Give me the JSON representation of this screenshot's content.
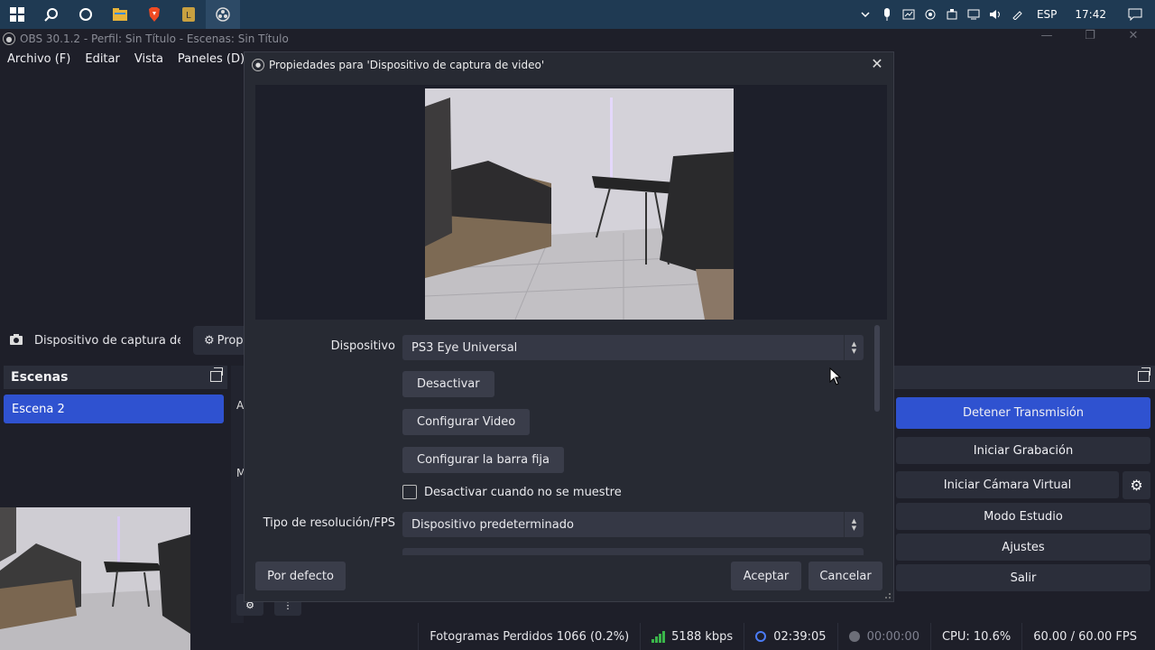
{
  "taskbar": {
    "icons": [
      "windows-start-icon",
      "search-icon",
      "cortana-icon",
      "file-explorer-icon",
      "brave-icon",
      "app-icon",
      "obs-icon"
    ],
    "tray": {
      "language": "ESP",
      "time": "17:42"
    }
  },
  "app": {
    "title": "OBS 30.1.2 - Perfil: Sin Título - Escenas: Sin Título"
  },
  "menu": {
    "items": [
      "Archivo (F)",
      "Editar",
      "Vista",
      "Paneles (D)"
    ]
  },
  "sources_toolbar": {
    "source_name": "Dispositivo de captura de v",
    "properties_label": "Prop"
  },
  "scenes": {
    "title": "Escenas",
    "items": [
      "Escena 2"
    ]
  },
  "mixer": {
    "a_label": "A",
    "m_label": "M"
  },
  "controls": {
    "buttons": [
      "Detener Transmisión",
      "Iniciar Grabación",
      "Iniciar Cámara Virtual",
      "Modo Estudio",
      "Ajustes",
      "Salir"
    ]
  },
  "statusbar": {
    "dropped_frames": "Fotogramas Perdidos 1066 (0.2%)",
    "bitrate": "5188 kbps",
    "stream_time": "02:39:05",
    "rec_time": "00:00:00",
    "cpu": "CPU: 10.6%",
    "fps": "60.00 / 60.00 FPS"
  },
  "dialog": {
    "title": "Propiedades para 'Dispositivo de captura de video'",
    "device_label": "Dispositivo",
    "device_value": "PS3 Eye Universal",
    "deactivate_btn": "Desactivar",
    "config_video_btn": "Configurar Video",
    "config_bar_btn": "Configurar la barra fija",
    "checkbox_label": "Desactivar cuando no se muestre",
    "resolution_label": "Tipo de resolución/FPS",
    "resolution_value": "Dispositivo predeterminado",
    "default_btn": "Por defecto",
    "accept_btn": "Aceptar",
    "cancel_btn": "Cancelar"
  },
  "colors": {
    "accent": "#2f52d0",
    "background": "#1e1f29",
    "taskbar": "#1f3a53"
  }
}
